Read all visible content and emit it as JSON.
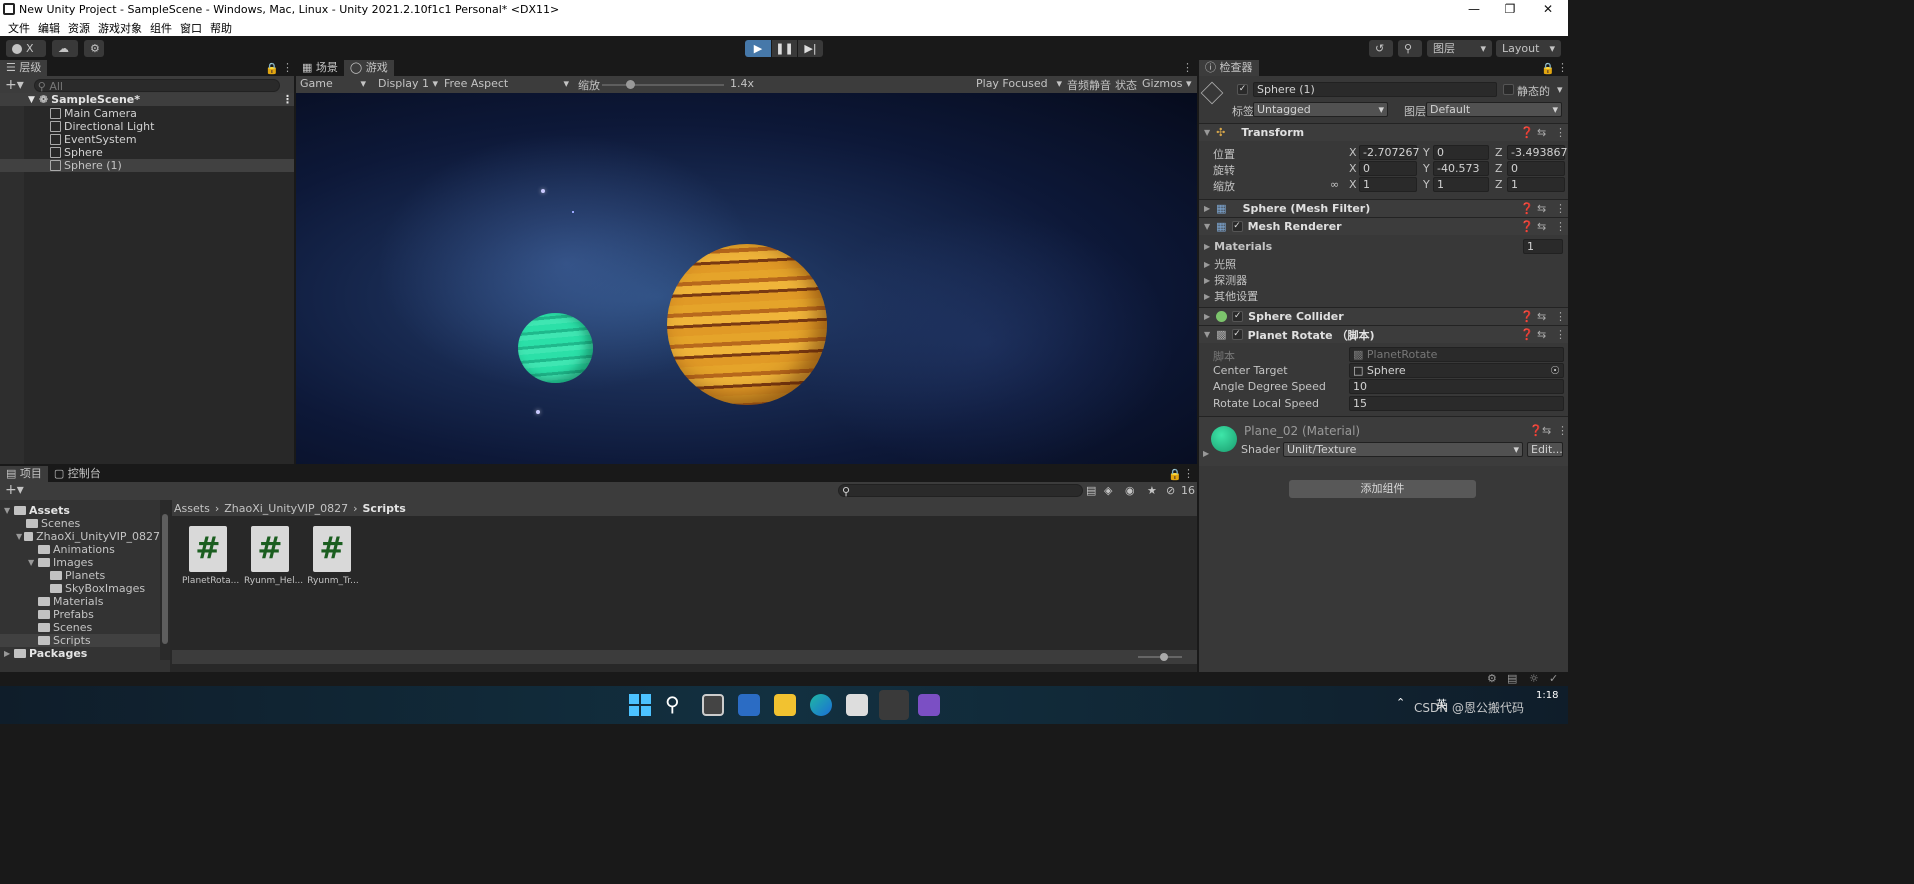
{
  "title": "New Unity Project - SampleScene - Windows, Mac, Linux - Unity 2021.2.10f1c1 Personal* <DX11>",
  "menu": [
    "文件",
    "编辑",
    "资源",
    "游戏对象",
    "组件",
    "窗口",
    "帮助"
  ],
  "toolbar": {
    "account": "X",
    "layers": "图层",
    "layout": "Layout"
  },
  "hierarchy": {
    "tab": "层级",
    "search_placeholder": "All",
    "scene": "SampleScene*",
    "items": [
      "Main Camera",
      "Directional Light",
      "EventSystem",
      "Sphere",
      "Sphere (1)"
    ]
  },
  "scene_tabs": {
    "scene": "场景",
    "game": "游戏"
  },
  "game_bar": {
    "mode": "Game",
    "display": "Display 1",
    "aspect": "Free Aspect",
    "scale_label": "缩放",
    "scale_value": "1.4x",
    "play_focused": "Play Focused",
    "mute": "音频静音",
    "stats": "状态",
    "gizmos": "Gizmos"
  },
  "inspector": {
    "tab": "检查器",
    "object_name": "Sphere (1)",
    "static": "静态的",
    "tag_label": "标签",
    "tag": "Untagged",
    "layer_label": "图层",
    "layer": "Default",
    "transform": {
      "title": "Transform",
      "position_label": "位置",
      "position": {
        "x": "-2.707267",
        "y": "0",
        "z": "-3.493867"
      },
      "rotation_label": "旋转",
      "rotation": {
        "x": "0",
        "y": "-40.573",
        "z": "0"
      },
      "scale_label": "缩放",
      "scale": {
        "x": "1",
        "y": "1",
        "z": "1"
      }
    },
    "mesh_filter": "Sphere (Mesh Filter)",
    "mesh_renderer": {
      "title": "Mesh Renderer",
      "materials": "Materials",
      "materials_count": "1",
      "sub": [
        "光照",
        "探测器",
        "其他设置"
      ]
    },
    "sphere_collider": "Sphere Collider",
    "planet_rotate": {
      "title": "Planet Rotate （脚本)",
      "script_label": "脚本",
      "script": "PlanetRotate",
      "center_target_label": "Center Target",
      "center_target": "Sphere",
      "angle_label": "Angle Degree Speed",
      "angle": "10",
      "local_label": "Rotate Local Speed",
      "local": "15"
    },
    "material": {
      "name": "Plane_02 (Material)",
      "shader_label": "Shader",
      "shader": "Unlit/Texture",
      "edit": "Edit..."
    },
    "add_component": "添加组件"
  },
  "project": {
    "tabs": [
      "项目",
      "控制台"
    ],
    "count": "16",
    "breadcrumb": [
      "Assets",
      "ZhaoXi_UnityVIP_0827",
      "Scripts"
    ],
    "tree": [
      {
        "label": "Assets",
        "level": 0,
        "bold": true
      },
      {
        "label": "Scenes",
        "level": 1
      },
      {
        "label": "ZhaoXi_UnityVIP_0827",
        "level": 1
      },
      {
        "label": "Animations",
        "level": 2
      },
      {
        "label": "Images",
        "level": 2
      },
      {
        "label": "Planets",
        "level": 3
      },
      {
        "label": "SkyBoxImages",
        "level": 3
      },
      {
        "label": "Materials",
        "level": 2
      },
      {
        "label": "Prefabs",
        "level": 2
      },
      {
        "label": "Scenes",
        "level": 2
      },
      {
        "label": "Scripts",
        "level": 2
      },
      {
        "label": "Packages",
        "level": 0,
        "bold": true
      }
    ],
    "files": [
      "PlanetRota...",
      "Ryunm_Hel...",
      "Ryunm_Tr..."
    ]
  },
  "taskbar": {
    "ime": "英",
    "time": "1:18",
    "watermark": "CSDN @恩公搬代码"
  },
  "colors": {
    "accent": "#2c5d87",
    "planet_gold": "#e7a324",
    "planet_green": "#35d79a",
    "sky": "#101c3c"
  }
}
